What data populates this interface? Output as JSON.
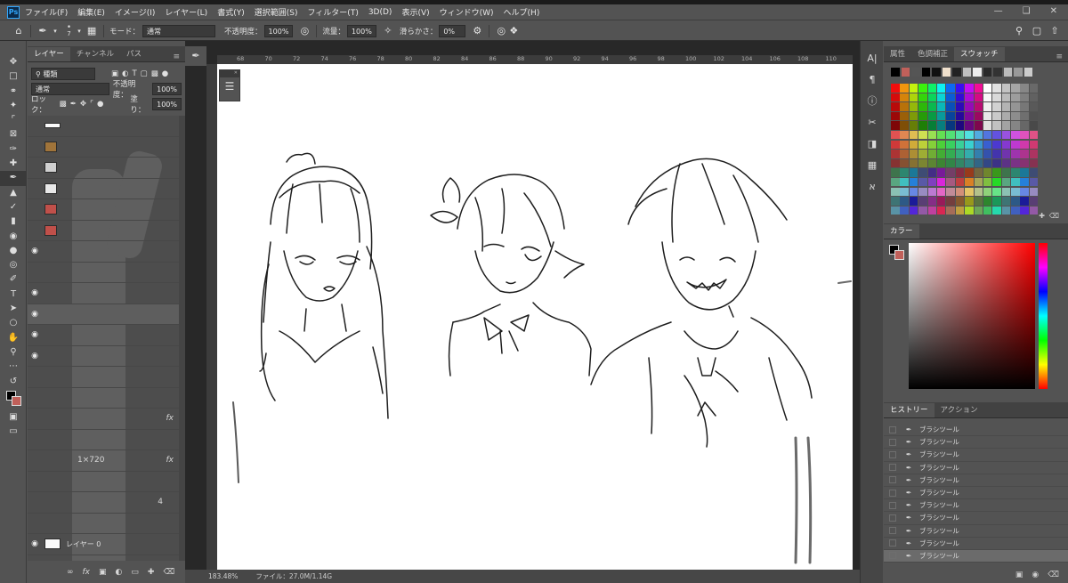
{
  "menubar": {
    "logo": "Ps",
    "items": [
      "ファイル(F)",
      "編集(E)",
      "イメージ(I)",
      "レイヤー(L)",
      "書式(Y)",
      "選択範囲(S)",
      "フィルター(T)",
      "3D(D)",
      "表示(V)",
      "ウィンドウ(W)",
      "ヘルプ(H)"
    ]
  },
  "options": {
    "brush_size": "7",
    "mode_label": "モード：",
    "mode_value": "通常",
    "opacity_label": "不透明度：",
    "opacity_value": "100%",
    "flow_label": "流量：",
    "flow_value": "100%",
    "smoothing_label": "滑らかさ：",
    "smoothing_value": "0%"
  },
  "layers_panel": {
    "tabs": [
      "レイヤー",
      "チャンネル",
      "パス"
    ],
    "filter_label": "種類",
    "blend_mode": "通常",
    "opacity_label": "不透明度：",
    "opacity_value": "100%",
    "lock_label": "ロック：",
    "fill_label": "塗り：",
    "fill_value": "100%",
    "fragment_fx1": "fx",
    "fragment_fx2": "fx",
    "fragment_size": "1×720",
    "fragment_4": "4",
    "bottom_layer": "レイヤー 0"
  },
  "ruler_labels": [
    "68",
    "70",
    "72",
    "74",
    "76",
    "78",
    "80",
    "82",
    "84",
    "86",
    "88",
    "90",
    "92",
    "94",
    "96",
    "98",
    "100",
    "102",
    "104",
    "106",
    "108",
    "110"
  ],
  "status": {
    "zoom": "183.48%",
    "file": "ファイル：27.0M/1.14G"
  },
  "right_panel": {
    "swatch_tabs": [
      "属性",
      "色調補正",
      "スウォッチ"
    ],
    "color_tab": "カラー",
    "history_tabs": [
      "ヒストリー",
      "アクション"
    ],
    "history_items": [
      "ブラシツール",
      "ブラシツール",
      "ブラシツール",
      "ブラシツール",
      "ブラシツール",
      "ブラシツール",
      "ブラシツール",
      "ブラシツール",
      "ブラシツール",
      "ブラシツール",
      "ブラシツール"
    ]
  },
  "colors": {
    "foreground": "#000000",
    "background": "#c0605a"
  }
}
